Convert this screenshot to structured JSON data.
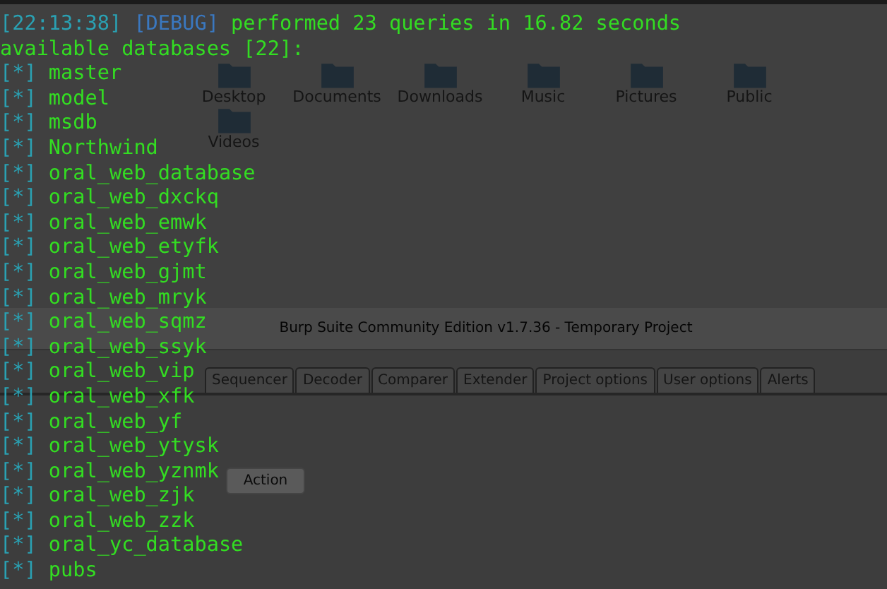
{
  "desktop": {
    "icons_row_1": [
      {
        "label": "Desktop"
      },
      {
        "label": "Documents"
      },
      {
        "label": "Downloads"
      },
      {
        "label": "Music"
      },
      {
        "label": "Pictures"
      },
      {
        "label": "Public"
      }
    ],
    "icons_row_2": [
      {
        "label": "Videos"
      }
    ]
  },
  "burp_window": {
    "title": "Burp Suite Community Edition v1.7.36 - Temporary Project",
    "tabs": [
      {
        "label": "Sequencer"
      },
      {
        "label": "Decoder"
      },
      {
        "label": "Comparer"
      },
      {
        "label": "Extender"
      },
      {
        "label": "Project options"
      },
      {
        "label": "User options"
      },
      {
        "label": "Alerts"
      }
    ],
    "action_button": "Action"
  },
  "terminal": {
    "log_lines": [
      {
        "timestamp": "[22:13:38]",
        "level": "[DEBUG]",
        "message": "performed 23 queries in 16.82 seconds"
      }
    ],
    "header": "available databases [22]:",
    "databases": [
      {
        "marker": "[*]",
        "name": "master"
      },
      {
        "marker": "[*]",
        "name": "model"
      },
      {
        "marker": "[*]",
        "name": "msdb"
      },
      {
        "marker": "[*]",
        "name": "Northwind"
      },
      {
        "marker": "[*]",
        "name": "oral_web_database"
      },
      {
        "marker": "[*]",
        "name": "oral_web_dxckq"
      },
      {
        "marker": "[*]",
        "name": "oral_web_emwk"
      },
      {
        "marker": "[*]",
        "name": "oral_web_etyfk"
      },
      {
        "marker": "[*]",
        "name": "oral_web_gjmt"
      },
      {
        "marker": "[*]",
        "name": "oral_web_mryk"
      },
      {
        "marker": "[*]",
        "name": "oral_web_sqmz"
      },
      {
        "marker": "[*]",
        "name": "oral_web_ssyk"
      },
      {
        "marker": "[*]",
        "name": "oral_web_vip"
      },
      {
        "marker": "[*]",
        "name": "oral_web_xfk"
      },
      {
        "marker": "[*]",
        "name": "oral_web_yf"
      },
      {
        "marker": "[*]",
        "name": "oral_web_ytysk"
      },
      {
        "marker": "[*]",
        "name": "oral_web_yznmk"
      },
      {
        "marker": "[*]",
        "name": "oral_web_zjk"
      },
      {
        "marker": "[*]",
        "name": "oral_web_zzk"
      },
      {
        "marker": "[*]",
        "name": "oral_yc_database"
      },
      {
        "marker": "[*]",
        "name": "pubs"
      }
    ]
  }
}
